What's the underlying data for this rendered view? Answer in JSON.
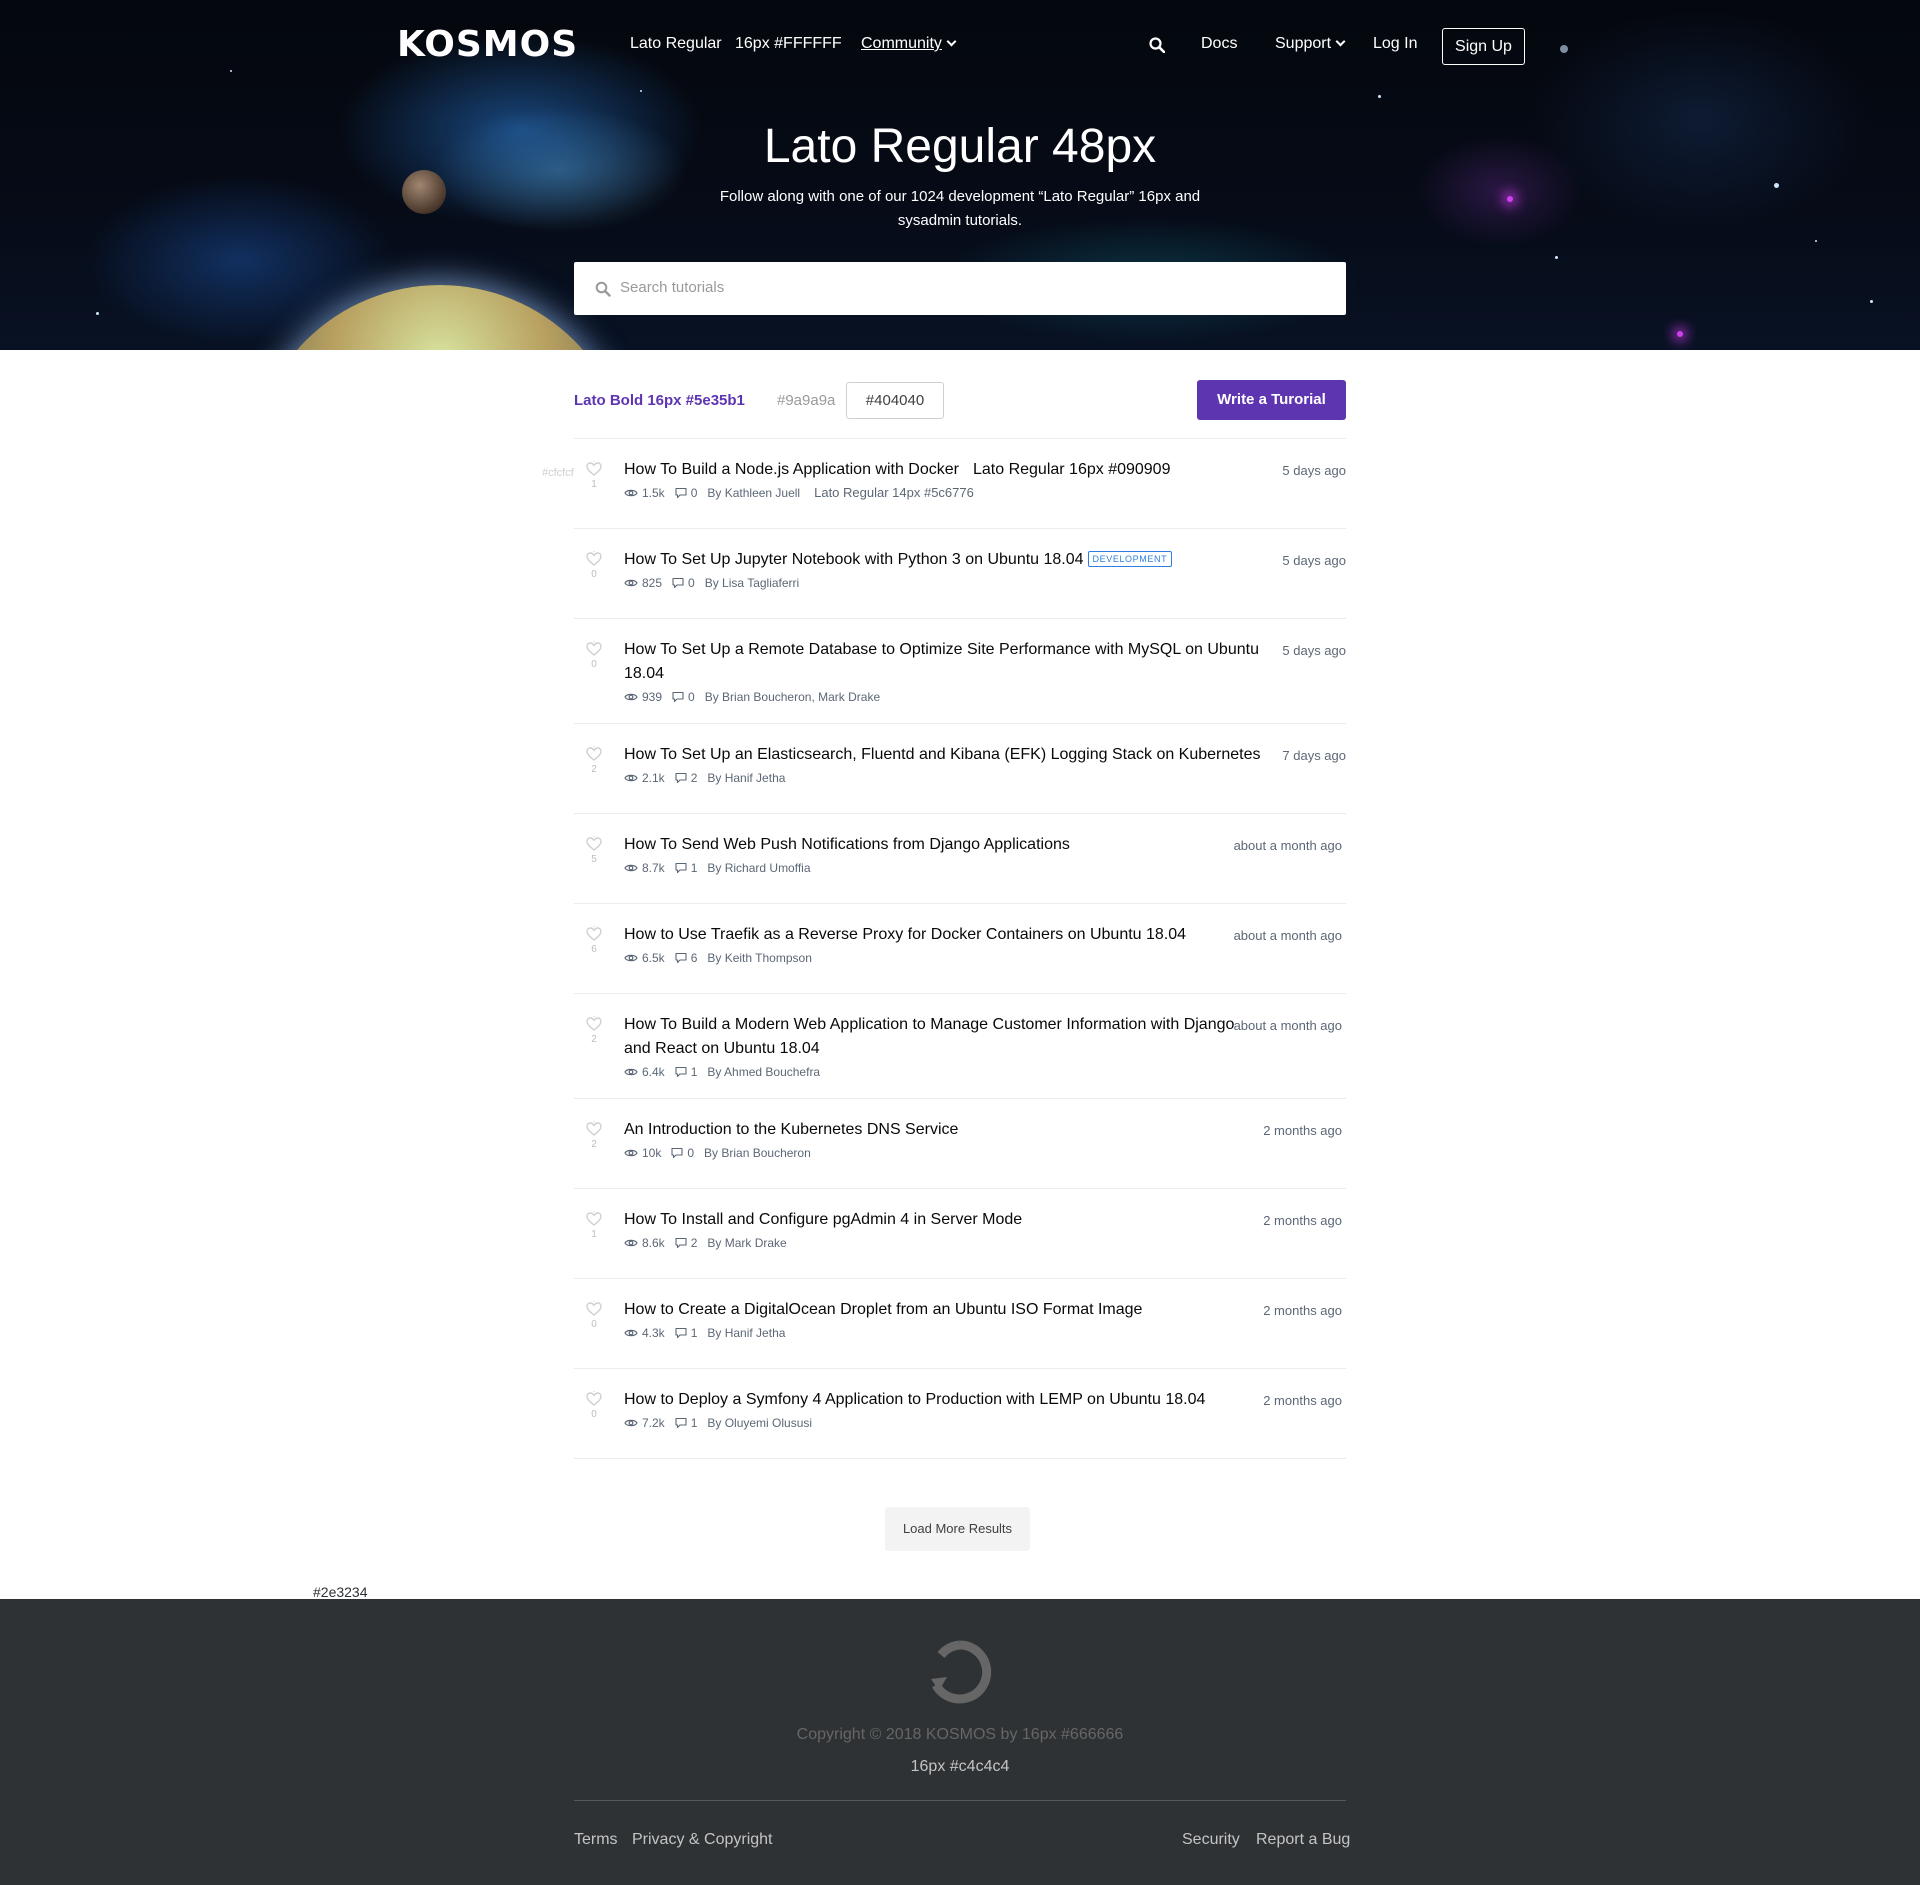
{
  "header": {
    "logo": "KOSMOS",
    "nav_left": [
      "Lato Regular",
      "16px #FFFFFF",
      "Community"
    ],
    "nav_right": [
      "Docs",
      "Support",
      "Log In"
    ],
    "signup": "Sign Up",
    "title": "Lato Regular 48px",
    "subtitle": "Follow along with one of our 1024 development “Lato Regular” 16px and sysadmin tutorials.",
    "search_placeholder": "Search tutorials"
  },
  "toolbar": {
    "active_filter": "Lato Bold 16px #5e35b1",
    "muted_filter": "#9a9a9a",
    "boxed_filter": "#404040",
    "write_button": "Write a Turorial"
  },
  "annotations": {
    "vote_color": "#cfcfcf",
    "title_note": "Lato Regular 16px #090909",
    "meta_note": "Lato Regular 14px #5c6776",
    "footer_bg": "#2e3234"
  },
  "tutorials": [
    {
      "title": "How To Build a Node.js Application with Docker",
      "votes": "1",
      "views": "1.5k",
      "comments": "0",
      "author": "By Kathleen Juell",
      "time": "5 days ago",
      "tag": ""
    },
    {
      "title": "How To Set Up Jupyter Notebook with Python 3 on Ubuntu 18.04",
      "votes": "0",
      "views": "825",
      "comments": "0",
      "author": "By Lisa Tagliaferri",
      "time": "5 days ago",
      "tag": "DEVELOPMENT"
    },
    {
      "title": "How To Set Up a Remote Database to Optimize Site Performance with MySQL on Ubuntu 18.04",
      "votes": "0",
      "views": "939",
      "comments": "0",
      "author": "By Brian Boucheron, Mark Drake",
      "time": "5 days ago",
      "tag": ""
    },
    {
      "title": "How To Set Up an Elasticsearch, Fluentd and Kibana (EFK) Logging Stack on Kubernetes",
      "votes": "2",
      "views": "2.1k",
      "comments": "2",
      "author": "By Hanif Jetha",
      "time": "7 days ago",
      "tag": ""
    },
    {
      "title": "How To Send Web Push Notifications from Django Applications",
      "votes": "5",
      "views": "8.7k",
      "comments": "1",
      "author": "By Richard Umoffia",
      "time": "about a month ago",
      "tag": ""
    },
    {
      "title": "How to Use Traefik as a Reverse Proxy for Docker Containers on Ubuntu 18.04",
      "votes": "6",
      "views": "6.5k",
      "comments": "6",
      "author": "By Keith Thompson",
      "time": "about a month ago",
      "tag": ""
    },
    {
      "title": "How To Build a Modern Web Application to Manage Customer Information with Django and React on Ubuntu 18.04",
      "votes": "2",
      "views": "6.4k",
      "comments": "1",
      "author": "By Ahmed Bouchefra",
      "time": "about a month ago",
      "tag": ""
    },
    {
      "title": "An Introduction to the Kubernetes DNS Service",
      "votes": "2",
      "views": "10k",
      "comments": "0",
      "author": "By Brian Boucheron",
      "time": "2 months ago",
      "tag": ""
    },
    {
      "title": "How To Install and Configure pgAdmin 4 in Server Mode",
      "votes": "1",
      "views": "8.6k",
      "comments": "2",
      "author": "By Mark Drake",
      "time": "2 months ago",
      "tag": ""
    },
    {
      "title": "How to Create a DigitalOcean Droplet from an Ubuntu ISO Format Image",
      "votes": "0",
      "views": "4.3k",
      "comments": "1",
      "author": "By Hanif Jetha",
      "time": "2 months ago",
      "tag": ""
    },
    {
      "title": "How to Deploy a Symfony 4 Application to Production with LEMP on Ubuntu 18.04",
      "votes": "0",
      "views": "7.2k",
      "comments": "1",
      "author": "By Oluyemi Olususi",
      "time": "2 months ago",
      "tag": ""
    }
  ],
  "load_more": "Load More Results",
  "footer": {
    "copyright": "Copyright © 2018 KOSMOS by 16px #666666",
    "subline": "16px #c4c4c4",
    "links_left": [
      "Terms",
      "Privacy & Copyright"
    ],
    "links_right": [
      "Security",
      "Report a Bug"
    ]
  },
  "colors": {
    "accent": "#5e35b1",
    "title_text": "#090909",
    "meta_text": "#5c6776",
    "footer_bg": "#2e3234",
    "badge": "#2d7ee0"
  }
}
